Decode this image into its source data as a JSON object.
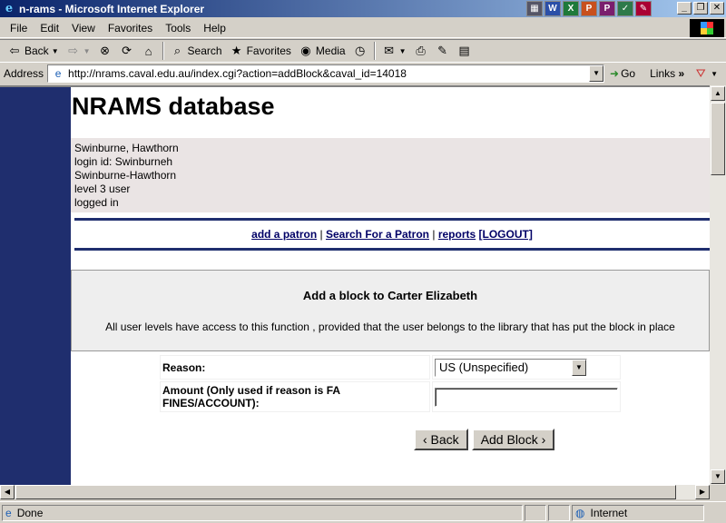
{
  "window": {
    "title": "n-rams - Microsoft Internet Explorer"
  },
  "menu": [
    {
      "label": "File",
      "key": "F"
    },
    {
      "label": "Edit",
      "key": "E"
    },
    {
      "label": "View",
      "key": "V"
    },
    {
      "label": "Favorites",
      "key": "a"
    },
    {
      "label": "Tools",
      "key": "T"
    },
    {
      "label": "Help",
      "key": "H"
    }
  ],
  "toolbar": {
    "back": "Back",
    "search": "Search",
    "favorites": "Favorites",
    "media": "Media"
  },
  "address": {
    "label": "Address",
    "url": "http://nrams.caval.edu.au/index.cgi?action=addBlock&caval_id=14018",
    "go": "Go",
    "links": "Links"
  },
  "page": {
    "title": "NRAMS database",
    "user": {
      "line1": "Swinburne, Hawthorn",
      "line2": "login id: Swinburneh",
      "line3": "Swinburne-Hawthorn",
      "line4": "level 3 user",
      "line5": "logged in"
    },
    "nav": {
      "add_patron": "add a patron",
      "search_patron": "Search For a Patron",
      "reports": "reports",
      "logout": "[LOGOUT]",
      "sep": "|"
    },
    "panel": {
      "heading": "Add a block to Carter Elizabeth",
      "description": "All user levels have access to this function , provided that the user belongs to the library that has put the block in place"
    },
    "form": {
      "reason_label": "Reason:",
      "reason_value": "US (Unspecified)",
      "amount_label": "Amount (Only used if reason is FA FINES/ACCOUNT):",
      "amount_value": ""
    },
    "buttons": {
      "back": "‹ Back",
      "add_block": "Add Block ›"
    }
  },
  "status": {
    "text": "Done",
    "zone": "Internet"
  }
}
